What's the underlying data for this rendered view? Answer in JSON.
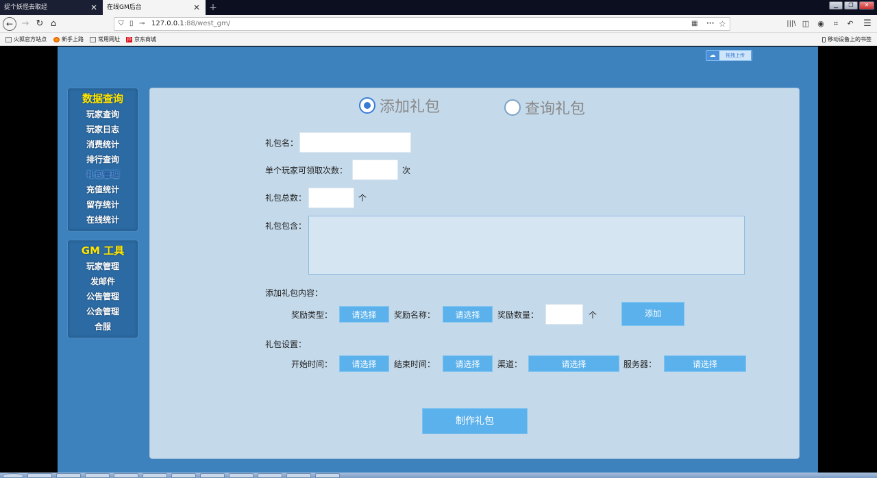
{
  "browser": {
    "tabs": [
      {
        "label": "捉个妖怪去取经",
        "active": false
      },
      {
        "label": "在线GM后台",
        "active": true
      }
    ],
    "url": {
      "host": "127.0.0.1",
      "port": ":88",
      "path": "/west_gm/"
    },
    "bookmarks": [
      {
        "label": "火狐官方站点",
        "icon": "folder-icon"
      },
      {
        "label": "新手上路",
        "icon": "firefox-icon"
      },
      {
        "label": "常用网址",
        "icon": "folder-icon"
      },
      {
        "label": "京东商城",
        "icon": "jd-icon"
      }
    ],
    "mobile_bookmarks": "移动设备上的书签"
  },
  "sidebar": {
    "data_query": {
      "title": "数据查询",
      "items": [
        "玩家查询",
        "玩家日志",
        "消费统计",
        "排行查询",
        "礼包管理",
        "充值统计",
        "留存统计",
        "在线统计"
      ],
      "active_index": 4
    },
    "gm_tools": {
      "title": "GM 工具",
      "items": [
        "玩家管理",
        "发邮件",
        "公告管理",
        "公会管理",
        "合服"
      ]
    }
  },
  "main": {
    "mode_options": [
      {
        "label": "添加礼包",
        "checked": true
      },
      {
        "label": "查询礼包",
        "checked": false
      }
    ],
    "upload_button": "拖拽上传",
    "form": {
      "gift_name_label": "礼包名：",
      "per_player_label": "单个玩家可领取次数：",
      "per_player_unit": "次",
      "total_label": "礼包总数：",
      "total_unit": "个",
      "contains_label": "礼包包含：",
      "add_content_label": "添加礼包内容：",
      "reward_type_label": "奖励类型：",
      "reward_name_label": "奖励名称：",
      "reward_count_label": "奖励数量：",
      "reward_count_unit": "个",
      "select_placeholder": "请选择",
      "add_button": "添加",
      "settings_label": "礼包设置：",
      "start_time_label": "开始时间：",
      "end_time_label": "结束时间：",
      "channel_label": "渠道：",
      "server_label": "服务器：",
      "make_button": "制作礼包"
    }
  },
  "colors": {
    "page_bg": "#3d82bd",
    "panel_bg": "#c4d9ea",
    "button_blue": "#5bb1ec",
    "sidebar_title": "#ffe600"
  }
}
